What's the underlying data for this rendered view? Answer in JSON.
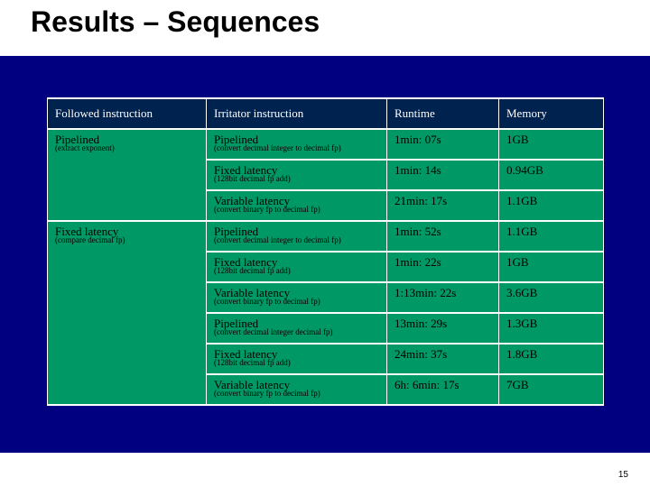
{
  "chart_data": {
    "type": "table",
    "title": "Results – Sequences",
    "columns": [
      "Followed instruction",
      "Irritator instruction",
      "Runtime",
      "Memory"
    ],
    "rows": [
      {
        "followed": "Pipelined",
        "followed_sub": "(extract exponent)",
        "irritator": "Pipelined",
        "irritator_sub": "(convert decimal integer to decimal fp)",
        "runtime": "1min: 07s",
        "memory": "1GB"
      },
      {
        "followed": "",
        "followed_sub": "",
        "irritator": "Fixed latency",
        "irritator_sub": "(128bit decimal fp add)",
        "runtime": "1min: 14s",
        "memory": "0.94GB"
      },
      {
        "followed": "",
        "followed_sub": "",
        "irritator": "Variable latency",
        "irritator_sub": "(convert binary fp to decimal fp)",
        "runtime": "21min: 17s",
        "memory": "1.1GB"
      },
      {
        "followed": "Fixed latency",
        "followed_sub": "(compare decimal fp)",
        "irritator": "Pipelined",
        "irritator_sub": "(convert decimal integer to decimal fp)",
        "runtime": "1min: 52s",
        "memory": "1.1GB"
      },
      {
        "followed": "",
        "followed_sub": "",
        "irritator": "Fixed latency",
        "irritator_sub": "(128bit decimal fp add)",
        "runtime": "1min: 22s",
        "memory": "1GB"
      },
      {
        "followed": "",
        "followed_sub": "",
        "irritator": "Variable latency",
        "irritator_sub": "(convert binary fp to decimal fp)",
        "runtime": "1:13min: 22s",
        "memory": "3.6GB"
      },
      {
        "followed": "",
        "followed_sub": "",
        "irritator": "Pipelined",
        "irritator_sub": "(convert decimal integer decimal fp)",
        "runtime": "13min: 29s",
        "memory": "1.3GB"
      },
      {
        "followed": "",
        "followed_sub": "",
        "irritator": "Fixed latency",
        "irritator_sub": "(128bit decimal fp add)",
        "runtime": "24min: 37s",
        "memory": "1.8GB"
      },
      {
        "followed": "",
        "followed_sub": "",
        "irritator": "Variable latency",
        "irritator_sub": "(convert binary fp  to decimal fp)",
        "runtime": "6h: 6min: 17s",
        "memory": "7GB"
      }
    ]
  },
  "title": "Results – Sequences",
  "headers": {
    "c0": "Followed instruction",
    "c1": "Irritator instruction",
    "c2": "Runtime",
    "c3": "Memory"
  },
  "page_number": "15"
}
